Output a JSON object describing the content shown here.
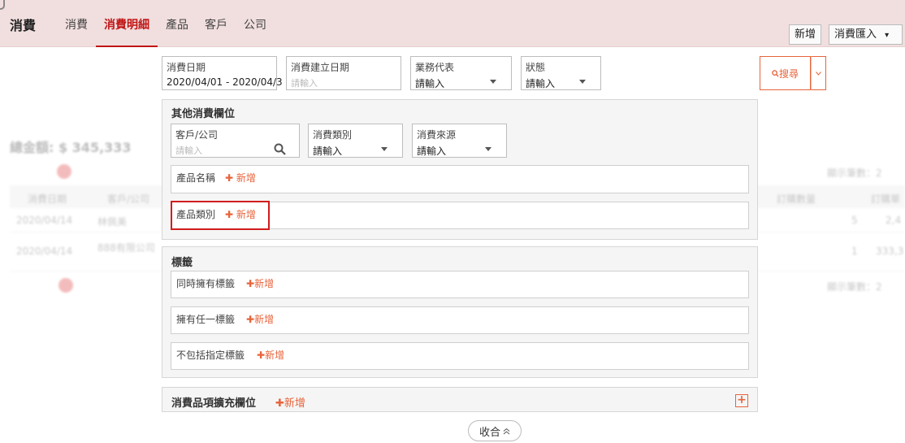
{
  "header": {
    "app_title": "消費",
    "tabs": [
      {
        "label": "消費"
      },
      {
        "label": "消費明細"
      },
      {
        "label": "產品"
      },
      {
        "label": "客戶"
      },
      {
        "label": "公司"
      }
    ],
    "new_button": "新增",
    "import_button": "消費匯入",
    "import_caret": "▾"
  },
  "background": {
    "total": "總金額: $ 345,333",
    "display_count_top": "顯示筆數：2",
    "display_count_bottom": "顯示筆數：2",
    "columns": [
      "消費日期",
      "客戶/公司",
      "訂購數量",
      "訂購單"
    ],
    "rows": [
      {
        "date": "2020/04/14",
        "customer": "林佩美",
        "qty": "5",
        "price": "2,4"
      },
      {
        "date": "2020/04/14",
        "customer": "888有限公司",
        "qty": "1",
        "price": "333,3"
      }
    ]
  },
  "filters": {
    "date": {
      "label": "消費日期",
      "value": "2020/04/01 - 2020/04/3"
    },
    "created_date": {
      "label": "消費建立日期",
      "placeholder": "請輸入"
    },
    "sales_rep": {
      "label": "業務代表",
      "value": "請輸入"
    },
    "status": {
      "label": "狀態",
      "value": "請輸入"
    },
    "search_button": "搜尋"
  },
  "other_fields": {
    "title": "其他消費欄位",
    "customer": {
      "label": "客戶/公司",
      "placeholder": "請輸入"
    },
    "category": {
      "label": "消費類別",
      "value": "請輸入"
    },
    "source": {
      "label": "消費來源",
      "value": "請輸入"
    },
    "product_name": {
      "label": "產品名稱",
      "add": "新增"
    },
    "product_category": {
      "label": "產品類別",
      "add": "新增"
    }
  },
  "tags": {
    "title": "標籤",
    "has_all": {
      "label": "同時擁有標籤",
      "add": "新增"
    },
    "has_any": {
      "label": "擁有任一標籤",
      "add": "新增"
    },
    "exclude": {
      "label": "不包括指定標籤",
      "add": "新增"
    }
  },
  "extension": {
    "title": "消費品項擴充欄位",
    "add": "新增"
  },
  "collapse_button": "收合",
  "colors": {
    "accent": "#e7643c",
    "active_tab": "#c01515",
    "header_bg": "#f1dede",
    "highlight": "#d11c1c"
  }
}
